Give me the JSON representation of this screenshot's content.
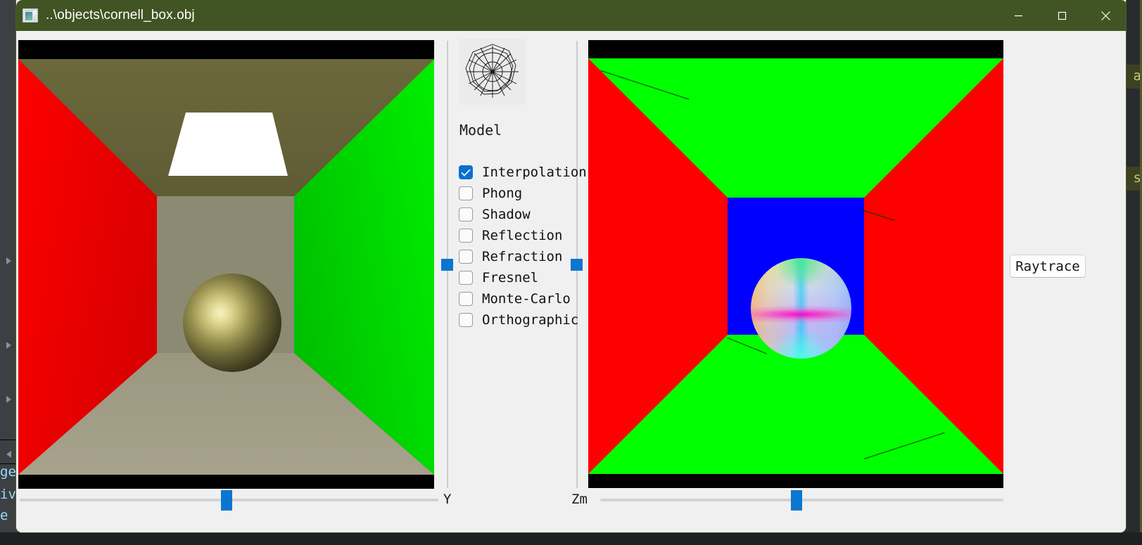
{
  "window": {
    "title": "..\\objects\\cornell_box.obj",
    "icon": "app-window-icon",
    "titlebar_color": "#415423",
    "controls": {
      "minimize": "minimize-icon",
      "maximize": "maximize-icon",
      "close": "close-icon"
    }
  },
  "panel": {
    "thumbnail_icon": "wireframe-sphere-icon",
    "model_label": "Model",
    "accent_color": "#0b6fd0",
    "options": [
      {
        "label": "Interpolation",
        "checked": true
      },
      {
        "label": "Phong",
        "checked": false
      },
      {
        "label": "Shadow",
        "checked": false
      },
      {
        "label": "Reflection",
        "checked": false
      },
      {
        "label": "Refraction",
        "checked": false
      },
      {
        "label": "Fresnel",
        "checked": false
      },
      {
        "label": "Monte-Carlo",
        "checked": false
      },
      {
        "label": "Orthographic",
        "checked": false
      }
    ]
  },
  "actions": {
    "raytrace_label": "Raytrace"
  },
  "sliders": {
    "y_label": "Y",
    "zm_label": "Zm"
  },
  "viewports": {
    "left": {
      "name": "shaded-cornell-box",
      "colors": {
        "left_wall": "#ff0000",
        "right_wall": "#00f000",
        "ceiling": "#6e6a3e",
        "floor": "#a9a48d",
        "back_wall": "#8d8a73",
        "light": "#ffffff",
        "sphere_highlight": "#f6f3c2"
      }
    },
    "right": {
      "name": "flat-shaded-cornell-box",
      "colors": {
        "side_walls": "#ff0000",
        "ceiling_floor": "#00ff00",
        "back_wall": "#0000ff"
      }
    }
  },
  "background": {
    "left_fragments": [
      "ge",
      "iv",
      "e"
    ],
    "right_fragments": [
      "a",
      "s"
    ]
  }
}
